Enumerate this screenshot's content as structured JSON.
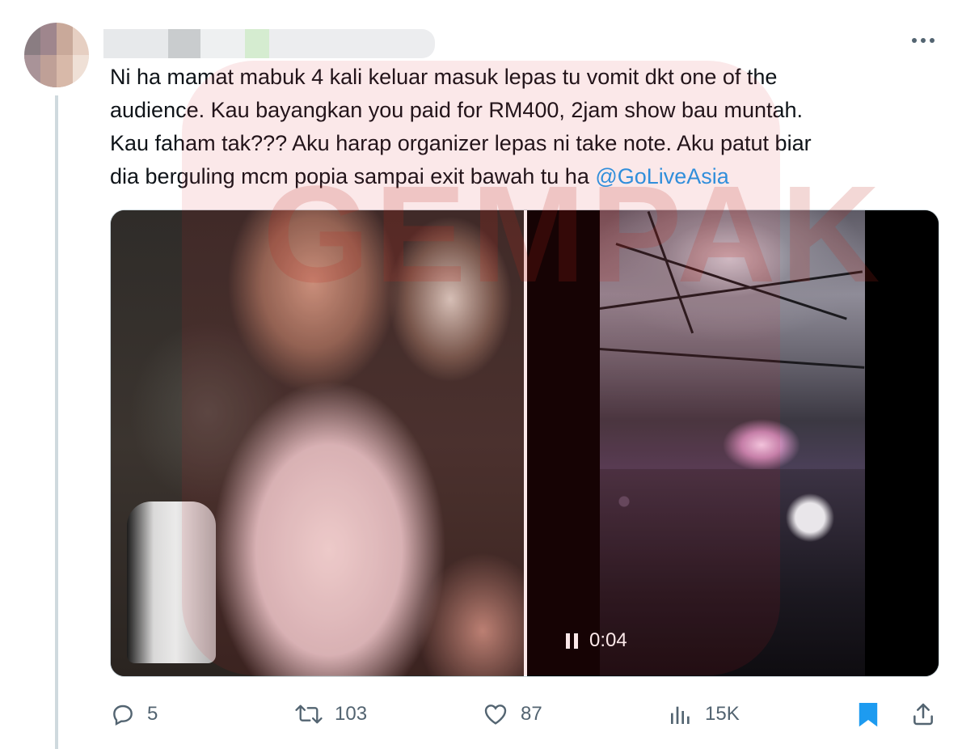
{
  "tweet": {
    "text_parts": {
      "line1": "Ni ha mamat mabuk 4 kali keluar masuk lepas tu vomit dkt one of the",
      "line2": "audience. Kau bayangkan you paid for RM400, 2jam show bau muntah.",
      "line3": "Kau faham tak??? Aku harap organizer lepas ni take note. Aku patut biar",
      "line4": "dia berguling mcm popia sampai exit bawah tu ha ",
      "mention": "@GoLiveAsia"
    },
    "more_icon": "more-horizontal-icon"
  },
  "media": {
    "video_time": "0:04",
    "pause_icon": "pause-icon"
  },
  "watermark": {
    "text": "GEMPAK"
  },
  "actions": {
    "reply_count": "5",
    "retweet_count": "103",
    "like_count": "87",
    "views_count": "15K",
    "bookmark_active": true,
    "accent_color": "#1d9bf0",
    "muted_color": "#536471"
  }
}
